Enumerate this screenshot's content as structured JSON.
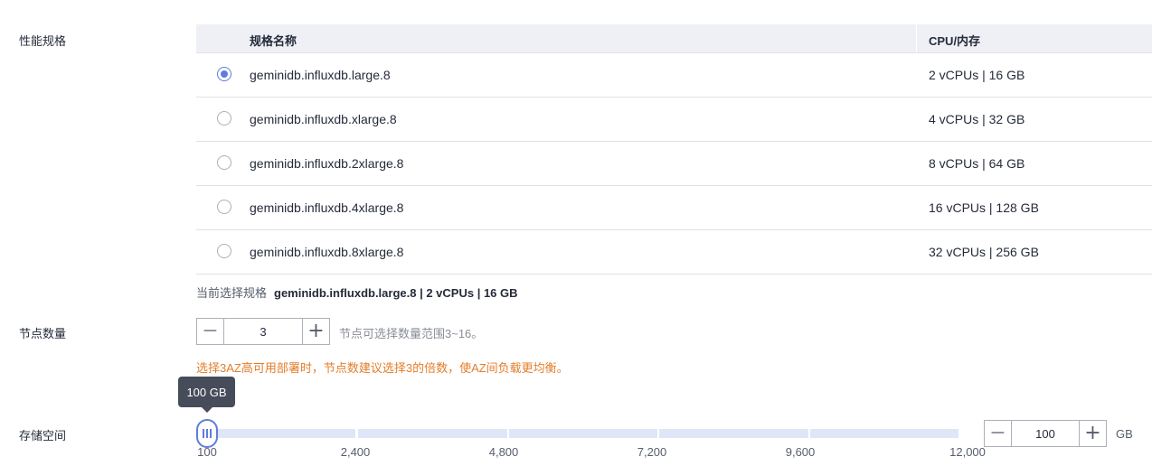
{
  "labels": {
    "performance_spec": "性能规格",
    "node_count": "节点数量",
    "storage": "存储空间"
  },
  "spec_table": {
    "col_name": "规格名称",
    "col_cpu": "CPU/内存",
    "rows": [
      {
        "name": "geminidb.influxdb.large.8",
        "cpu": "2 vCPUs | 16 GB",
        "selected": true
      },
      {
        "name": "geminidb.influxdb.xlarge.8",
        "cpu": "4 vCPUs | 32 GB",
        "selected": false
      },
      {
        "name": "geminidb.influxdb.2xlarge.8",
        "cpu": "8 vCPUs | 64 GB",
        "selected": false
      },
      {
        "name": "geminidb.influxdb.4xlarge.8",
        "cpu": "16 vCPUs | 128 GB",
        "selected": false
      },
      {
        "name": "geminidb.influxdb.8xlarge.8",
        "cpu": "32 vCPUs | 256 GB",
        "selected": false
      }
    ]
  },
  "current_spec": {
    "label": "当前选择规格",
    "value": "geminidb.influxdb.large.8 | 2 vCPUs | 16 GB"
  },
  "node": {
    "value": "3",
    "hint": "节点可选择数量范围3~16。",
    "warning": "选择3AZ高可用部署时，节点数建议选择3的倍数，使AZ间负载更均衡。"
  },
  "storage": {
    "tooltip": "100 GB",
    "value": "100",
    "unit": "GB",
    "min": 100,
    "max": 12000,
    "ticks": [
      "100",
      "2,400",
      "4,800",
      "7,200",
      "9,600",
      "12,000"
    ]
  },
  "colors": {
    "accent": "#5e7ce0",
    "warning": "#e37d29",
    "header_bg": "#eef0f5",
    "track": "#dfe6f7"
  },
  "icons": {
    "minus": "minus-icon",
    "plus": "plus-icon",
    "slider_grip": "grip-icon"
  }
}
